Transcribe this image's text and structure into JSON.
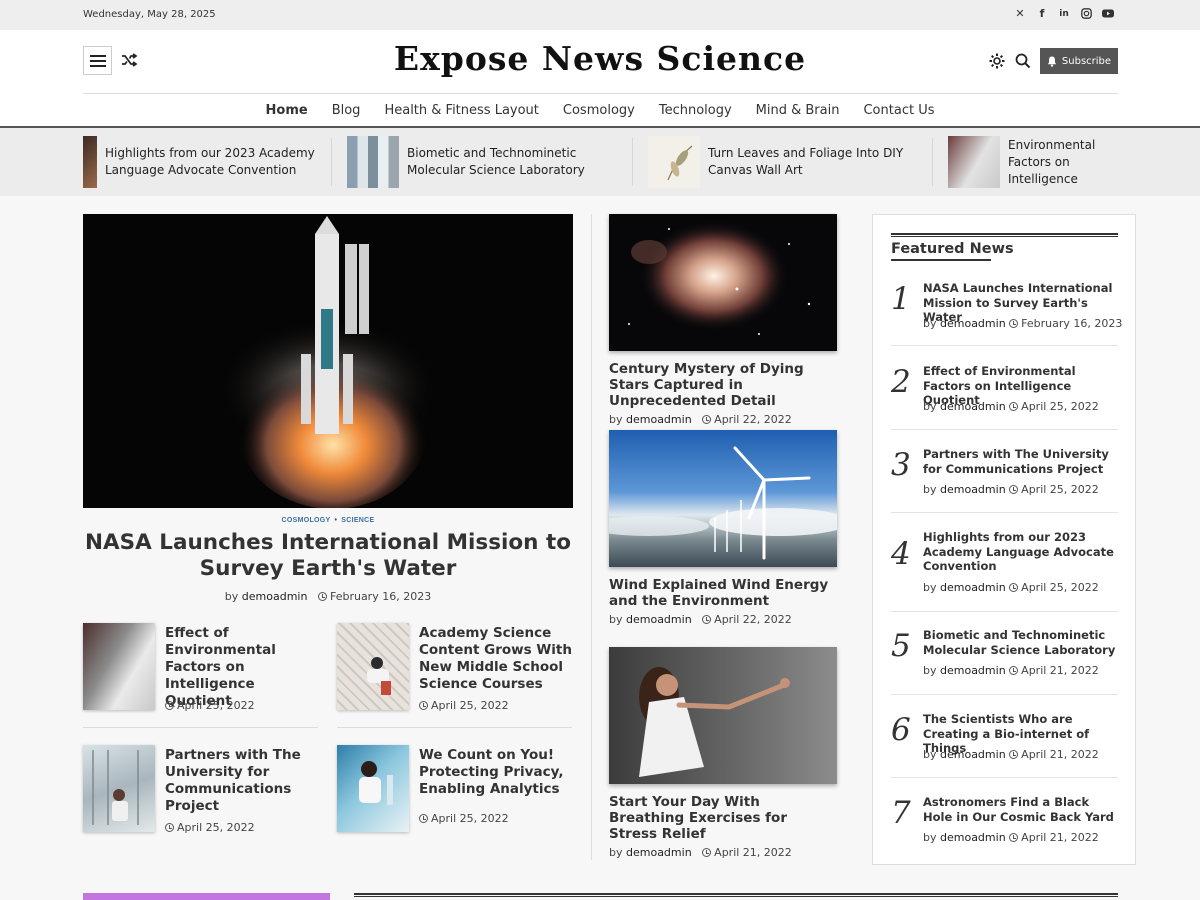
{
  "topbar": {
    "date": "Wednesday, May 28, 2025",
    "socials": [
      "x-icon",
      "facebook-icon",
      "linkedin-icon",
      "instagram-icon",
      "youtube-icon"
    ]
  },
  "header": {
    "site_title": "Expose News Science",
    "subscribe_label": "Subscribe"
  },
  "nav": [
    "Home",
    "Blog",
    "Health & Fitness Layout",
    "Cosmology",
    "Technology",
    "Mind & Brain",
    "Contact Us"
  ],
  "ticker": [
    {
      "title": "Highlights from our 2023 Academy Language Advocate Convention"
    },
    {
      "title": "Biometic and Technominetic Molecular Science Laboratory"
    },
    {
      "title": "Turn Leaves and Foliage Into DIY Canvas Wall Art"
    },
    {
      "title": "Effect of Environmental Factors on Intelligence Quotient"
    }
  ],
  "hero": {
    "categories": [
      "COSMOLOGY",
      "SCIENCE"
    ],
    "title": "NASA Launches International Mission to Survey Earth's Water",
    "author_prefix": "by",
    "author": "demoadmin",
    "date": "February 16, 2023"
  },
  "small_posts": [
    {
      "title": "Effect of Environmental Factors on Intelligence Quotient",
      "date": "April 25, 2022"
    },
    {
      "title": "Academy Science Content Grows With New Middle School Science Courses",
      "date": "April 25, 2022"
    },
    {
      "title": "Partners with The University for Communications Project",
      "date": "April 25, 2022"
    },
    {
      "title": "We Count on You! Protecting Privacy, Enabling Analytics",
      "date": "April 25, 2022"
    }
  ],
  "mid_posts": [
    {
      "title": "Century Mystery of Dying Stars Captured in Unprecedented Detail",
      "author": "demoadmin",
      "date": "April 22, 2022"
    },
    {
      "title": "Wind Explained Wind Energy and the Environment",
      "author": "demoadmin",
      "date": "April 22, 2022"
    },
    {
      "title": "Start Your Day With Breathing Exercises for Stress Relief",
      "author": "demoadmin",
      "date": "April 21, 2022"
    }
  ],
  "sidebar": {
    "title": "Featured News",
    "items": [
      {
        "num": "1",
        "title": "NASA Launches International Mission to Survey Earth's Water",
        "author": "demoadmin",
        "date": "February 16, 2023"
      },
      {
        "num": "2",
        "title": "Effect of Environmental Factors on Intelligence Quotient",
        "author": "demoadmin",
        "date": "April 25, 2022"
      },
      {
        "num": "3",
        "title": "Partners with The University for Communications Project",
        "author": "demoadmin",
        "date": "April 25, 2022"
      },
      {
        "num": "4",
        "title": "Highlights from our 2023 Academy Language Advocate Convention",
        "author": "demoadmin",
        "date": "April 25, 2022"
      },
      {
        "num": "5",
        "title": "Biometic and Technominetic Molecular Science Laboratory",
        "author": "demoadmin",
        "date": "April 21, 2022"
      },
      {
        "num": "6",
        "title": "The Scientists Who are Creating a Bio-internet of Things",
        "author": "demoadmin",
        "date": "April 21, 2022"
      },
      {
        "num": "7",
        "title": "Astronomers Find a Black Hole in Our Cosmic Back Yard",
        "author": "demoadmin",
        "date": "April 21, 2022"
      }
    ]
  },
  "colors": {
    "accent": "#3a6fa8",
    "subscribe_bg": "#555555",
    "purple_bar": "#c376e0"
  }
}
